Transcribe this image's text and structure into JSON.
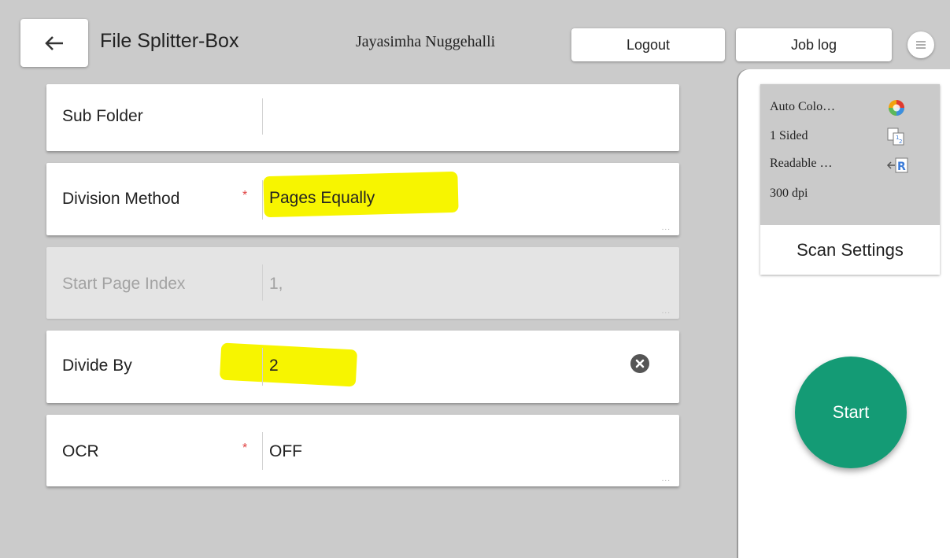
{
  "header": {
    "back_icon": "arrow-left-icon",
    "title": "File Splitter-Box",
    "user_name": "Jayasimha Nuggehalli",
    "logout_label": "Logout",
    "joblog_label": "Job log",
    "menu_icon": "hamburger-menu-icon"
  },
  "form": {
    "rows": [
      {
        "label": "Sub Folder",
        "required": false,
        "value": "",
        "disabled": false,
        "has_more": false
      },
      {
        "label": "Division Method",
        "required": true,
        "value": "Pages Equally",
        "disabled": false,
        "has_more": true
      },
      {
        "label": "Start Page Index",
        "required": false,
        "value": "1,",
        "disabled": true,
        "has_more": true
      },
      {
        "label": "Divide By",
        "required": false,
        "value": "2",
        "disabled": false,
        "has_clear": true
      },
      {
        "label": "OCR",
        "required": true,
        "value": "OFF",
        "disabled": false,
        "has_more": true
      }
    ],
    "required_mark": "*",
    "more_mark": "...",
    "highlight_color": "#f7f500"
  },
  "scan_settings": {
    "lines": [
      {
        "text": "Auto Colo…",
        "icon": "auto-color-icon"
      },
      {
        "text": "1 Sided",
        "icon": "one-sided-icon"
      },
      {
        "text": "Readable …",
        "icon": "orientation-icon"
      },
      {
        "text": "300 dpi",
        "icon": ""
      }
    ],
    "label": "Scan Settings"
  },
  "start": {
    "label": "Start",
    "color": "#149b75"
  }
}
